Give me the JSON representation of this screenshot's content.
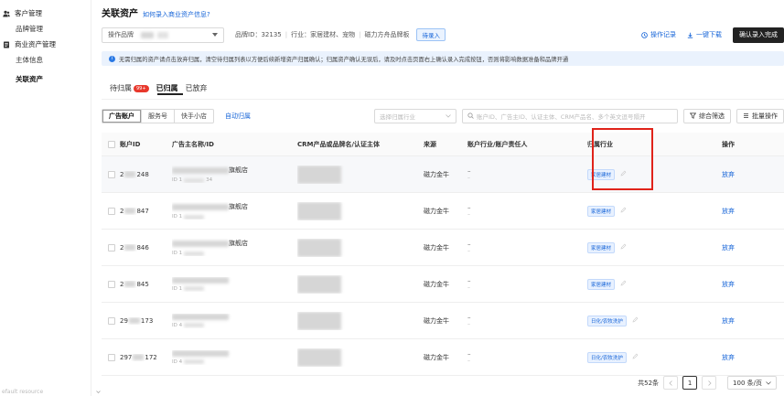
{
  "sidebar": {
    "groups": [
      {
        "label": "客户管理",
        "icon": "users-icon",
        "items": [
          {
            "label": "品牌管理",
            "active": false
          }
        ]
      },
      {
        "label": "商业资产管理",
        "icon": "document-icon",
        "items": [
          {
            "label": "主体信息",
            "active": false
          },
          {
            "label": "关联资产",
            "active": true
          }
        ]
      }
    ],
    "footer_text": "efault resource"
  },
  "header": {
    "title": "关联资产",
    "help_link": "如何录入商业资产信息?"
  },
  "toprow": {
    "select_prefix": "操作品牌",
    "brand_id_label": "品牌ID：32135",
    "industry_label": "行业：家居建材、宠物",
    "category_label": "磁力方舟品牌板",
    "status_tag": "待录入",
    "op_log": "操作记录",
    "download": "一键下载",
    "confirm": "确认录入完成"
  },
  "notice": {
    "text": "无需归属的资产请点击放弃归属，清空待归属列表以方便后续新增资产归属确认；归属资产确认无误后，请及时点击页面右上确认录入完成按钮，否则将影响数据准备和品牌开通"
  },
  "tabs": [
    {
      "label": "待归属",
      "badge": "99+",
      "active": false
    },
    {
      "label": "已归属",
      "active": true
    },
    {
      "label": "已放弃",
      "active": false
    }
  ],
  "filters": {
    "segments": [
      {
        "label": "广告账户",
        "active": true
      },
      {
        "label": "服务号",
        "active": false
      },
      {
        "label": "快手小店",
        "active": false
      }
    ],
    "auto_attr": "自动归属",
    "industry_placeholder": "选择归属行业",
    "search_placeholder": "账户ID、广告主ID、认证主体、CRM产品名、多个英文逗号隔开",
    "composite": "综合筛选",
    "batch": "批量操作"
  },
  "table": {
    "columns": [
      "账户ID",
      "广告主名称/ID",
      "CRM产品或品牌名/认证主体",
      "来源",
      "账户行业/账户责任人",
      "归属行业",
      "操作"
    ],
    "rows": [
      {
        "id_pre": "2",
        "id_suf": "248",
        "name_suf": "旗舰店",
        "sub_id": "ID 1",
        "sub_tail": "34",
        "source": "磁力金牛",
        "industry": "家居建材",
        "action": "放弃"
      },
      {
        "id_pre": "2",
        "id_suf": "847",
        "name_suf": "旗舰店",
        "sub_id": "ID 1",
        "sub_tail": "",
        "source": "磁力金牛",
        "industry": "家居建材",
        "action": "放弃"
      },
      {
        "id_pre": "2",
        "id_suf": "846",
        "name_suf": "旗舰店",
        "sub_id": "ID 1",
        "sub_tail": "",
        "source": "磁力金牛",
        "industry": "家居建材",
        "action": "放弃"
      },
      {
        "id_pre": "2",
        "id_suf": "845",
        "name_suf": "",
        "sub_id": "ID 1",
        "sub_tail": "",
        "source": "磁力金牛",
        "industry": "家居建材",
        "action": "放弃"
      },
      {
        "id_pre": "29",
        "id_suf": "173",
        "name_suf": "",
        "sub_id": "ID 4",
        "sub_tail": "",
        "source": "磁力金牛",
        "industry": "日化/农牧洗护",
        "action": "放弃"
      },
      {
        "id_pre": "297",
        "id_suf": "172",
        "name_suf": "",
        "sub_id": "ID 4",
        "sub_tail": "",
        "source": "磁力金牛",
        "industry": "日化/农牧洗护",
        "action": "放弃"
      }
    ]
  },
  "pager": {
    "total": "共52条",
    "current": "1",
    "page_size": "100 条/页"
  },
  "colors": {
    "accent": "#1765d8",
    "highlight_box": "#e0231a",
    "primary_button": "#222222"
  }
}
